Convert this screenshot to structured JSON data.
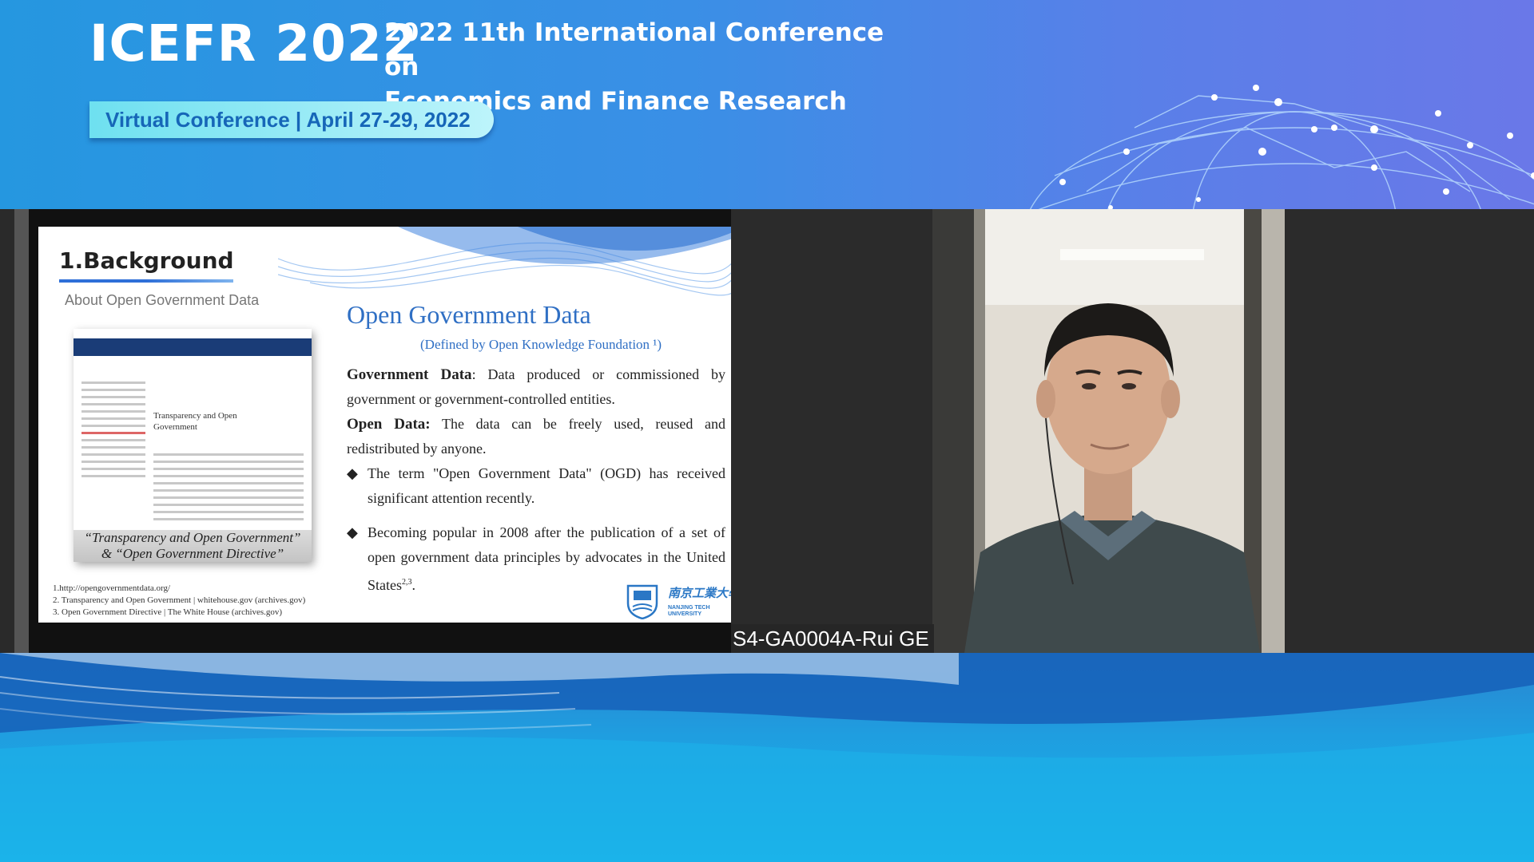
{
  "banner": {
    "abbreviation": "ICEFR 2022",
    "conference_line1": "2022 11th International Conference on",
    "conference_line2": "Economics and Finance Research",
    "badge": "Virtual Conference | April 27-29, 2022"
  },
  "slide": {
    "section_title": "1.Background",
    "section_subtitle": "About Open Government Data",
    "thumbnail": {
      "heading_line1": "Transparency and Open",
      "heading_line2": "Government",
      "caption_line1": "“Transparency and Open Government”",
      "caption_line2": "& “Open Government Directive”"
    },
    "heading": "Open Government Data",
    "heading_sub": "(Defined by Open Knowledge Foundation ¹)",
    "term1": "Government Data",
    "def1": ": Data produced or commissioned by government or government-controlled entities.",
    "term2": "Open Data:",
    "def2": " The data can be freely used, reused and redistributed by anyone.",
    "bullet1": "The term \"Open Government Data\" (OGD) has received significant attention recently.",
    "bullet2": "Becoming popular in 2008 after the publication of a set of open government data principles by advocates in the United States",
    "bullet2_sup": "2,3",
    "refs": [
      "1.http://opengovernmentdata.org/",
      "2. Transparency and Open Government | whitehouse.gov (archives.gov)",
      "3. Open Government Directive | The White House (archives.gov)"
    ],
    "logo_cn": "南京工業大學",
    "logo_en_line1": "NANJING TECH",
    "logo_en_line2": "UNIVERSITY"
  },
  "participant": {
    "label": "S4-GA0004A-Rui GE"
  },
  "colors": {
    "banner_blue": "#2597e0",
    "slide_accent": "#2f6fc4",
    "badge_text": "#1666b8"
  }
}
